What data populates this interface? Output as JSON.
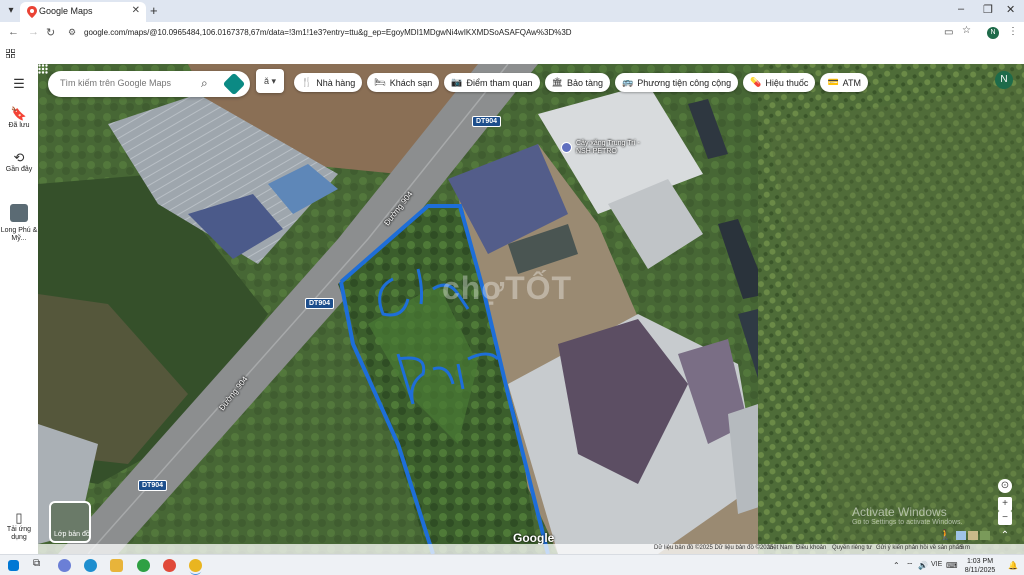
{
  "browser": {
    "tab_title": "Google Maps",
    "url": "google.com/maps/@10.0965484,106.0167378,67m/data=!3m1!1e3?entry=ttu&g_ep=EgoyMDI1MDgwNi4wIKXMDSoASAFQAw%3D%3D",
    "profile_initial": "N"
  },
  "sidebar": {
    "items": [
      {
        "label": "Đã lưu",
        "icon": "bookmark-icon"
      },
      {
        "label": "Gần đây",
        "icon": "history-icon"
      },
      {
        "label": "Long Phú & Mỹ...",
        "icon": "place-thumbnail"
      },
      {
        "label": "Tải ứng dụng",
        "icon": "phone-icon"
      }
    ]
  },
  "search": {
    "placeholder": "Tìm kiếm trên Google Maps"
  },
  "category_chips": [
    {
      "label": "Nhà hàng",
      "icon": "restaurant-icon"
    },
    {
      "label": "Khách sạn",
      "icon": "hotel-icon"
    },
    {
      "label": "Điểm tham quan",
      "icon": "camera-icon"
    },
    {
      "label": "Bảo tàng",
      "icon": "museum-icon"
    },
    {
      "label": "Phương tiện công cộng",
      "icon": "transit-icon"
    },
    {
      "label": "Hiệu thuốc",
      "icon": "pharmacy-icon"
    },
    {
      "label": "ATM",
      "icon": "atm-icon"
    }
  ],
  "map": {
    "road_shields": [
      "DT904",
      "DT904",
      "DT904"
    ],
    "road_names": [
      "Đường 904",
      "Đường 904"
    ],
    "poi": "Cây xăng Trung Trí - NSH PETRO",
    "watermark": "chợTỐT",
    "handwriting": [
      "Cần",
      "Bán"
    ],
    "layer_label": "Lớp bản đồ",
    "logo": "Google",
    "account_initial": "N"
  },
  "attribution": {
    "data": "Dữ liệu bản đồ ©2025  Dữ liệu bản đồ ©2025",
    "vietnam": "Việt Nam",
    "terms": "Điều khoản",
    "privacy": "Quyền riêng tư",
    "feedback": "Gửi ý kiến phản hồi về sản phẩm",
    "scale": "5 m"
  },
  "activation": {
    "title": "Activate Windows",
    "subtitle": "Go to Settings to activate Windows."
  },
  "taskbar": {
    "lang": "VIE",
    "time": "1:03 PM",
    "date": "8/11/2025"
  }
}
